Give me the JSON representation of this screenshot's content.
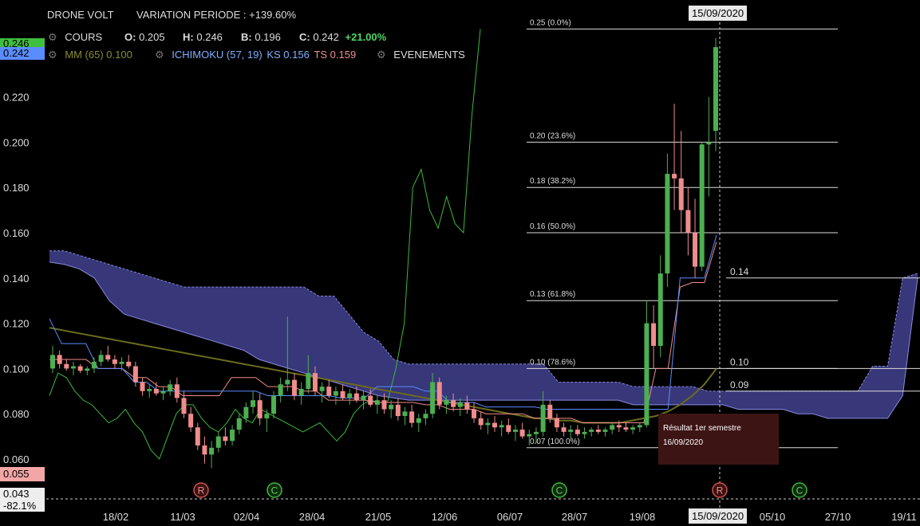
{
  "header": {
    "name": "DRONE VOLT",
    "variation": "VARIATION PERIODE : +139.60%",
    "cours_label": "COURS",
    "o_key": "O:",
    "o_val": "0.205",
    "h_key": "H:",
    "h_val": "0.246",
    "b_key": "B:",
    "b_val": "0.196",
    "c_key": "C:",
    "c_val": "0.242",
    "change": "+21.00%",
    "mm": "MM (65) 0.100",
    "ichimoku": "ICHIMOKU (57, 19)",
    "ks": "KS 0.156",
    "ts": "TS 0.159",
    "evenements": "EVENEMENTS"
  },
  "cursor_date_top": "15/09/2020",
  "cursor_date_bottom": "15/09/2020",
  "left_labels": {
    "high": "0.246",
    "last": "0.242",
    "low": "0.055",
    "cursor_value": "0.043",
    "cursor_pct": "-82.1%"
  },
  "tooltip": {
    "title": "Résultat 1er semestre",
    "date": "16/09/2020"
  },
  "colors": {
    "cloud": "#3d3d86",
    "cloud_edge": "#8a8ae0",
    "up": "#4caf50",
    "down": "#f08c8c",
    "ks": "#f08c8c",
    "tenkan": "#5b8cff",
    "mm": "#6b6b20",
    "chikou": "#3db83d"
  },
  "chart_data": {
    "type": "candlestick",
    "ylim": [
      0.043,
      0.265
    ],
    "y_ticks": [
      0.06,
      0.08,
      0.1,
      0.12,
      0.14,
      0.16,
      0.18,
      0.2,
      0.22
    ],
    "x_ticks": [
      "18/02",
      "11/03",
      "02/04",
      "28/04",
      "21/05",
      "12/06",
      "06/07",
      "28/07",
      "19/08",
      "05/10",
      "27/10",
      "19/11"
    ],
    "fibonacci": [
      {
        "price": 0.25,
        "label": "0.25  (0.0%)"
      },
      {
        "price": 0.2,
        "label": "0.20  (23.6%)"
      },
      {
        "price": 0.18,
        "label": "0.18  (38.2%)"
      },
      {
        "price": 0.16,
        "label": "0.16  (50.0%)"
      },
      {
        "price": 0.13,
        "label": "0.13  (61.8%)"
      },
      {
        "price": 0.1,
        "label": "0.10  (78.6%)"
      },
      {
        "price": 0.065,
        "label": "0.07  (100.0%)"
      }
    ],
    "price_levels": [
      {
        "price": 0.14,
        "label": "0.14"
      },
      {
        "price": 0.1,
        "label": "0.10"
      },
      {
        "price": 0.09,
        "label": "0.09"
      }
    ],
    "events": [
      {
        "date": "20/03",
        "letter": "R"
      },
      {
        "date": "20/04",
        "letter": "C"
      },
      {
        "date": "21/07",
        "letter": "C"
      },
      {
        "date": "15/09",
        "letter": "R"
      },
      {
        "date": "20/10",
        "letter": "C"
      }
    ],
    "series": [
      {
        "name": "COURS",
        "ohlc": [
          [
            0.1,
            0.11,
            0.098,
            0.106
          ],
          [
            0.106,
            0.108,
            0.1,
            0.102
          ],
          [
            0.102,
            0.104,
            0.099,
            0.1
          ],
          [
            0.1,
            0.103,
            0.097,
            0.101
          ],
          [
            0.101,
            0.102,
            0.098,
            0.099
          ],
          [
            0.099,
            0.101,
            0.097,
            0.1
          ],
          [
            0.1,
            0.105,
            0.098,
            0.103
          ],
          [
            0.103,
            0.108,
            0.101,
            0.106
          ],
          [
            0.106,
            0.11,
            0.103,
            0.104
          ],
          [
            0.104,
            0.106,
            0.1,
            0.102
          ],
          [
            0.102,
            0.105,
            0.099,
            0.103
          ],
          [
            0.103,
            0.106,
            0.1,
            0.101
          ],
          [
            0.101,
            0.103,
            0.092,
            0.094
          ],
          [
            0.094,
            0.096,
            0.088,
            0.09
          ],
          [
            0.09,
            0.093,
            0.087,
            0.091
          ],
          [
            0.091,
            0.094,
            0.088,
            0.089
          ],
          [
            0.089,
            0.092,
            0.086,
            0.09
          ],
          [
            0.09,
            0.095,
            0.088,
            0.093
          ],
          [
            0.093,
            0.096,
            0.085,
            0.087
          ],
          [
            0.087,
            0.09,
            0.078,
            0.08
          ],
          [
            0.08,
            0.083,
            0.072,
            0.074
          ],
          [
            0.074,
            0.076,
            0.064,
            0.066
          ],
          [
            0.066,
            0.07,
            0.058,
            0.062
          ],
          [
            0.062,
            0.068,
            0.056,
            0.065
          ],
          [
            0.065,
            0.072,
            0.063,
            0.07
          ],
          [
            0.07,
            0.074,
            0.066,
            0.068
          ],
          [
            0.068,
            0.075,
            0.066,
            0.073
          ],
          [
            0.073,
            0.08,
            0.071,
            0.078
          ],
          [
            0.078,
            0.085,
            0.076,
            0.083
          ],
          [
            0.083,
            0.09,
            0.08,
            0.086
          ],
          [
            0.086,
            0.089,
            0.075,
            0.078
          ],
          [
            0.078,
            0.082,
            0.072,
            0.08
          ],
          [
            0.08,
            0.09,
            0.078,
            0.088
          ],
          [
            0.088,
            0.096,
            0.085,
            0.093
          ],
          [
            0.093,
            0.123,
            0.09,
            0.095
          ],
          [
            0.095,
            0.098,
            0.086,
            0.088
          ],
          [
            0.088,
            0.094,
            0.084,
            0.091
          ],
          [
            0.091,
            0.106,
            0.089,
            0.098
          ],
          [
            0.098,
            0.101,
            0.088,
            0.09
          ],
          [
            0.09,
            0.094,
            0.085,
            0.092
          ],
          [
            0.092,
            0.095,
            0.087,
            0.088
          ],
          [
            0.088,
            0.092,
            0.084,
            0.09
          ],
          [
            0.09,
            0.093,
            0.086,
            0.087
          ],
          [
            0.087,
            0.091,
            0.084,
            0.089
          ],
          [
            0.089,
            0.092,
            0.085,
            0.086
          ],
          [
            0.086,
            0.09,
            0.082,
            0.088
          ],
          [
            0.088,
            0.091,
            0.083,
            0.084
          ],
          [
            0.084,
            0.088,
            0.08,
            0.086
          ],
          [
            0.086,
            0.089,
            0.08,
            0.082
          ],
          [
            0.082,
            0.086,
            0.078,
            0.084
          ],
          [
            0.084,
            0.087,
            0.077,
            0.079
          ],
          [
            0.079,
            0.083,
            0.075,
            0.081
          ],
          [
            0.081,
            0.084,
            0.074,
            0.076
          ],
          [
            0.076,
            0.08,
            0.072,
            0.078
          ],
          [
            0.078,
            0.082,
            0.075,
            0.08
          ],
          [
            0.08,
            0.098,
            0.078,
            0.094
          ],
          [
            0.094,
            0.096,
            0.082,
            0.084
          ],
          [
            0.084,
            0.088,
            0.08,
            0.086
          ],
          [
            0.086,
            0.089,
            0.081,
            0.083
          ],
          [
            0.083,
            0.087,
            0.079,
            0.085
          ],
          [
            0.085,
            0.088,
            0.08,
            0.082
          ],
          [
            0.082,
            0.085,
            0.076,
            0.078
          ],
          [
            0.078,
            0.081,
            0.073,
            0.075
          ],
          [
            0.075,
            0.078,
            0.071,
            0.076
          ],
          [
            0.076,
            0.079,
            0.072,
            0.074
          ],
          [
            0.074,
            0.077,
            0.07,
            0.075
          ],
          [
            0.075,
            0.078,
            0.071,
            0.072
          ],
          [
            0.072,
            0.075,
            0.068,
            0.073
          ],
          [
            0.073,
            0.076,
            0.069,
            0.07
          ],
          [
            0.07,
            0.073,
            0.066,
            0.071
          ],
          [
            0.071,
            0.074,
            0.067,
            0.072
          ],
          [
            0.072,
            0.09,
            0.07,
            0.084
          ],
          [
            0.084,
            0.086,
            0.076,
            0.078
          ],
          [
            0.078,
            0.08,
            0.072,
            0.074
          ],
          [
            0.074,
            0.076,
            0.07,
            0.072
          ],
          [
            0.072,
            0.075,
            0.069,
            0.073
          ],
          [
            0.073,
            0.075,
            0.07,
            0.071
          ],
          [
            0.071,
            0.074,
            0.069,
            0.072
          ],
          [
            0.072,
            0.074,
            0.07,
            0.073
          ],
          [
            0.073,
            0.075,
            0.071,
            0.072
          ],
          [
            0.072,
            0.074,
            0.07,
            0.073
          ],
          [
            0.073,
            0.076,
            0.071,
            0.075
          ],
          [
            0.075,
            0.077,
            0.072,
            0.074
          ],
          [
            0.074,
            0.076,
            0.072,
            0.073
          ],
          [
            0.073,
            0.075,
            0.071,
            0.074
          ],
          [
            0.074,
            0.076,
            0.072,
            0.075
          ],
          [
            0.075,
            0.13,
            0.074,
            0.12
          ],
          [
            0.12,
            0.128,
            0.1,
            0.11
          ],
          [
            0.11,
            0.15,
            0.105,
            0.142
          ],
          [
            0.142,
            0.195,
            0.136,
            0.186
          ],
          [
            0.186,
            0.217,
            0.17,
            0.184
          ],
          [
            0.184,
            0.205,
            0.16,
            0.17
          ],
          [
            0.17,
            0.18,
            0.15,
            0.16
          ],
          [
            0.16,
            0.175,
            0.14,
            0.145
          ],
          [
            0.145,
            0.2,
            0.143,
            0.199
          ],
          [
            0.199,
            0.22,
            0.176,
            0.2
          ],
          [
            0.205,
            0.246,
            0.196,
            0.242
          ]
        ]
      },
      {
        "name": "MM (65)",
        "values": [
          0.118,
          0.117,
          0.116,
          0.115,
          0.114,
          0.113,
          0.112,
          0.111,
          0.11,
          0.109,
          0.108,
          0.107,
          0.106,
          0.105,
          0.104,
          0.103,
          0.102,
          0.101,
          0.1,
          0.099,
          0.098,
          0.097,
          0.096,
          0.095,
          0.094,
          0.093,
          0.092,
          0.091,
          0.09,
          0.089,
          0.088,
          0.087,
          0.086,
          0.085,
          0.084,
          0.083,
          0.082,
          0.081,
          0.08,
          0.079,
          0.078,
          0.078,
          0.077,
          0.077,
          0.076,
          0.076,
          0.076,
          0.076,
          0.077,
          0.078,
          0.079,
          0.081,
          0.084,
          0.088,
          0.093,
          0.1
        ]
      },
      {
        "name": "KS",
        "values": [
          0.104,
          0.104,
          0.104,
          0.104,
          0.1,
          0.1,
          0.1,
          0.096,
          0.096,
          0.092,
          0.092,
          0.088,
          0.088,
          0.088,
          0.088,
          0.096,
          0.096,
          0.096,
          0.092,
          0.092,
          0.092,
          0.09,
          0.09,
          0.086,
          0.086,
          0.086,
          0.086,
          0.085,
          0.085,
          0.085,
          0.085,
          0.084,
          0.084,
          0.082,
          0.082,
          0.082,
          0.08,
          0.08,
          0.08,
          0.08,
          0.078,
          0.078,
          0.078,
          0.078,
          0.076,
          0.076,
          0.076,
          0.076,
          0.076,
          0.076,
          0.1,
          0.1,
          0.136,
          0.138,
          0.138,
          0.156
        ]
      },
      {
        "name": "TS",
        "values": [
          0.122,
          0.111,
          0.111,
          0.111,
          0.1,
          0.1,
          0.1,
          0.094,
          0.094,
          0.09,
          0.09,
          0.09,
          0.09,
          0.09,
          0.09,
          0.09,
          0.09,
          0.09,
          0.088,
          0.088,
          0.088,
          0.088,
          0.088,
          0.088,
          0.087,
          0.087,
          0.087,
          0.092,
          0.092,
          0.092,
          0.092,
          0.09,
          0.09,
          0.085,
          0.085,
          0.085,
          0.083,
          0.083,
          0.083,
          0.083,
          0.083,
          0.082,
          0.082,
          0.082,
          0.082,
          0.082,
          0.082,
          0.082,
          0.082,
          0.082,
          0.082,
          0.082,
          0.14,
          0.14,
          0.14,
          0.159
        ]
      },
      {
        "name": "Chikou",
        "values": [
          0.088,
          0.098,
          0.096,
          0.09,
          0.086,
          0.084,
          0.08,
          0.076,
          0.078,
          0.082,
          0.076,
          0.072,
          0.064,
          0.06,
          0.07,
          0.08,
          0.084,
          0.084,
          0.078,
          0.074,
          0.072,
          0.076,
          0.082,
          0.078,
          0.076,
          0.082,
          0.08,
          0.078,
          0.076,
          0.074,
          0.072,
          0.074,
          0.076,
          0.072,
          0.068,
          0.072,
          0.08,
          0.084,
          0.086,
          0.085,
          0.085,
          0.1,
          0.12,
          0.18,
          0.188,
          0.17,
          0.162,
          0.176,
          0.164,
          0.16,
          0.212,
          0.25
        ]
      },
      {
        "name": "Cloud top",
        "values": [
          0.152,
          0.152,
          0.15,
          0.148,
          0.146,
          0.144,
          0.142,
          0.14,
          0.138,
          0.136,
          0.136,
          0.136,
          0.136,
          0.136,
          0.136,
          0.136,
          0.136,
          0.136,
          0.132,
          0.132,
          0.124,
          0.116,
          0.112,
          0.104,
          0.102,
          0.102,
          0.102,
          0.102,
          0.102,
          0.102,
          0.102,
          0.102,
          0.102,
          0.102,
          0.094,
          0.094,
          0.094,
          0.094,
          0.094,
          0.092,
          0.092,
          0.092,
          0.092,
          0.092,
          0.09,
          0.09,
          0.09,
          0.09,
          0.09,
          0.09,
          0.09,
          0.09,
          0.09,
          0.09,
          0.09,
          0.101,
          0.101,
          0.14,
          0.142
        ]
      },
      {
        "name": "Cloud bottom",
        "values": [
          0.147,
          0.146,
          0.144,
          0.14,
          0.13,
          0.124,
          0.122,
          0.12,
          0.118,
          0.116,
          0.114,
          0.112,
          0.11,
          0.108,
          0.104,
          0.102,
          0.1,
          0.098,
          0.096,
          0.094,
          0.092,
          0.09,
          0.088,
          0.087,
          0.086,
          0.086,
          0.086,
          0.086,
          0.086,
          0.086,
          0.086,
          0.086,
          0.086,
          0.086,
          0.086,
          0.086,
          0.086,
          0.086,
          0.086,
          0.084,
          0.084,
          0.084,
          0.084,
          0.084,
          0.084,
          0.084,
          0.082,
          0.082,
          0.082,
          0.082,
          0.08,
          0.08,
          0.078,
          0.078,
          0.078,
          0.078,
          0.078,
          0.088,
          0.14
        ]
      }
    ]
  }
}
